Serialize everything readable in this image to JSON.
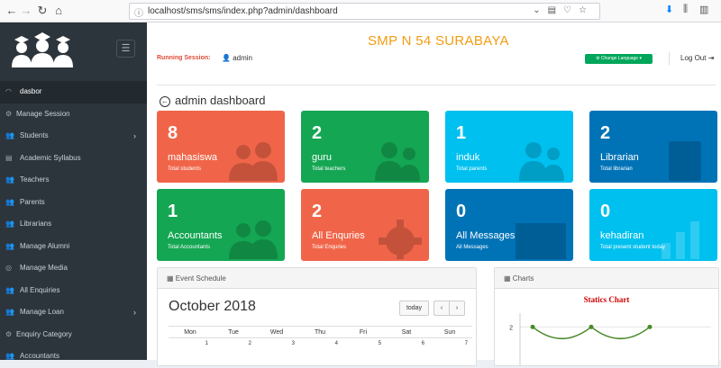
{
  "browser": {
    "url": "localhost/sms/sms/index.php?admin/dashboard"
  },
  "header": {
    "school_name": "SMP N 54 SURABAYA",
    "session_label": "Running Session:",
    "session_user": "admin",
    "change_language": "Change Language",
    "logout": "Log Out"
  },
  "sidebar": {
    "items": [
      {
        "label": "dasbor",
        "icon": "dashboard-icon",
        "active": true
      },
      {
        "label": "Manage Session",
        "icon": "gear-icon"
      },
      {
        "label": "Students",
        "icon": "users-icon",
        "arrow": true
      },
      {
        "label": "Academic Syllabus",
        "icon": "book-icon"
      },
      {
        "label": "Teachers",
        "icon": "users-icon"
      },
      {
        "label": "Parents",
        "icon": "users-icon"
      },
      {
        "label": "Librarians",
        "icon": "users-icon"
      },
      {
        "label": "Manage Alumni",
        "icon": "users-icon"
      },
      {
        "label": "Manage Media",
        "icon": "media-icon"
      },
      {
        "label": "All Enquiries",
        "icon": "users-icon"
      },
      {
        "label": "Manage Loan",
        "icon": "users-icon",
        "arrow": true
      },
      {
        "label": "Enquiry Category",
        "icon": "gear-icon"
      },
      {
        "label": "Accountants",
        "icon": "users-icon"
      }
    ]
  },
  "dashboard": {
    "title": "admin dashboard",
    "tiles": [
      {
        "value": "8",
        "title": "mahasiswa",
        "subtitle": "Total students",
        "color": "#f06549",
        "icon": "users-icon"
      },
      {
        "value": "2",
        "title": "guru",
        "subtitle": "Total teachers",
        "color": "#14a653",
        "icon": "user-icon"
      },
      {
        "value": "1",
        "title": "induk",
        "subtitle": "Total parents",
        "color": "#00c0ef",
        "icon": "user-icon"
      },
      {
        "value": "2",
        "title": "Librarian",
        "subtitle": "Total librarian",
        "color": "#0073b7",
        "icon": "book-icon"
      },
      {
        "value": "1",
        "title": "Accountants",
        "subtitle": "Total Accountants",
        "color": "#14a653",
        "icon": "users-icon"
      },
      {
        "value": "2",
        "title": "All Enquries",
        "subtitle": "Total Enquries",
        "color": "#f06549",
        "icon": "gear-icon"
      },
      {
        "value": "0",
        "title": "All Messages",
        "subtitle": "All Messages",
        "color": "#0073b7",
        "icon": "envelope-icon"
      },
      {
        "value": "0",
        "title": "kehadiran",
        "subtitle": "Total present student today",
        "color": "#00c0ef",
        "icon": "bar-chart-icon"
      }
    ]
  },
  "calendar": {
    "panel_title": "Event Schedule",
    "month": "October 2018",
    "today_label": "today",
    "prev_label": "‹",
    "next_label": "›",
    "days": [
      "Mon",
      "Tue",
      "Wed",
      "Thu",
      "Fri",
      "Sat",
      "Sun"
    ],
    "first_week": [
      "1",
      "2",
      "3",
      "4",
      "5",
      "6",
      "7"
    ]
  },
  "charts_panel": {
    "panel_title": "Charts"
  },
  "chart_data": {
    "type": "line",
    "title": "Statics Chart",
    "ytick_labels": [
      "3",
      "2"
    ],
    "series": [
      {
        "values": [
          2,
          2,
          2
        ]
      }
    ],
    "ylim": [
      0,
      3
    ],
    "color": "#4a8a2a"
  }
}
